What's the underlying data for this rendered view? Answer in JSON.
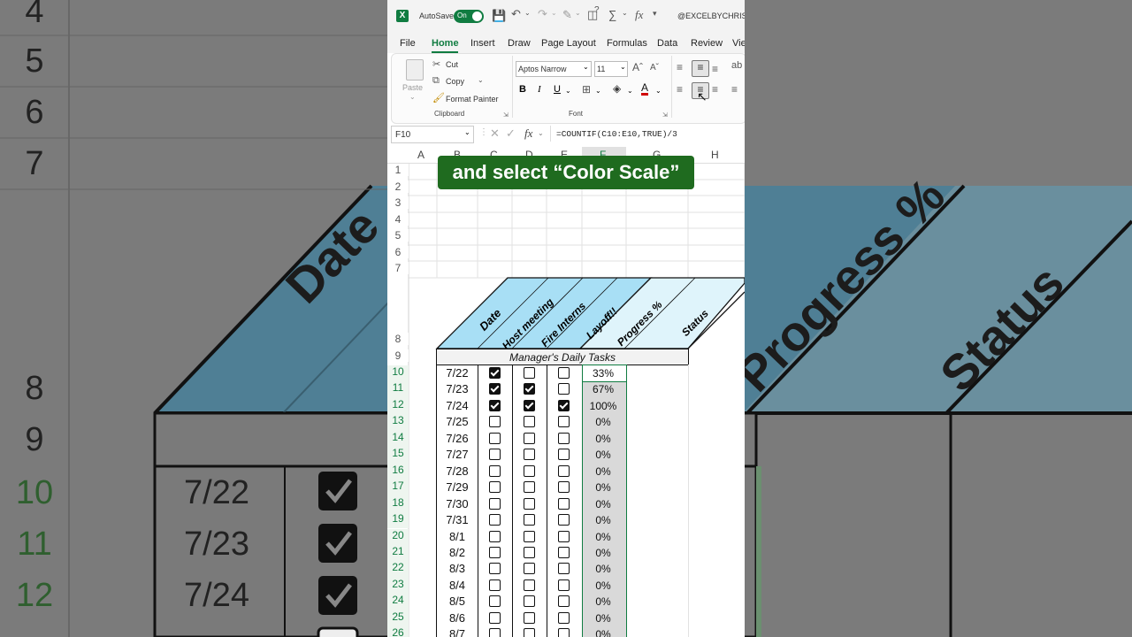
{
  "background": {
    "row_numbers": [
      "4",
      "5",
      "6",
      "7",
      "8",
      "9",
      "10",
      "11",
      "12"
    ],
    "dates": [
      "7/22",
      "7/23",
      "7/24"
    ],
    "headers": [
      "Date",
      "Progress %",
      "Status"
    ]
  },
  "titlebar": {
    "autosave_label": "AutoSave",
    "autosave_state": "On",
    "account": "@EXCELBYCHRIS T"
  },
  "tabs": [
    "File",
    "Home",
    "Insert",
    "Draw",
    "Page Layout",
    "Formulas",
    "Data",
    "Review",
    "Vie"
  ],
  "ribbon": {
    "paste": "Paste",
    "cut": "Cut",
    "copy": "Copy",
    "format_painter": "Format Painter",
    "clipboard_group": "Clipboard",
    "font_name": "Aptos Narrow",
    "font_size": "11",
    "font_group": "Font",
    "bold": "B",
    "italic": "I",
    "underline": "U"
  },
  "formula_bar": {
    "name_box": "F10",
    "formula": "=COUNTIF(C10:E10,TRUE)/3"
  },
  "columns": [
    "A",
    "B",
    "C",
    "D",
    "E",
    "F",
    "G",
    "H"
  ],
  "rows_top": [
    "1",
    "2",
    "3",
    "4",
    "5",
    "6",
    "7",
    "8",
    "9"
  ],
  "table": {
    "headers": [
      "Date",
      "Host meeting",
      "Fire Interns",
      "Layoff!!",
      "Progress %",
      "Status"
    ],
    "title": "Manager's Daily Tasks",
    "rows": [
      {
        "row": "10",
        "date": "7/22",
        "c": true,
        "d": false,
        "e": false,
        "pct": "33%"
      },
      {
        "row": "11",
        "date": "7/23",
        "c": true,
        "d": true,
        "e": false,
        "pct": "67%"
      },
      {
        "row": "12",
        "date": "7/24",
        "c": true,
        "d": true,
        "e": true,
        "pct": "100%"
      },
      {
        "row": "13",
        "date": "7/25",
        "c": false,
        "d": false,
        "e": false,
        "pct": "0%"
      },
      {
        "row": "14",
        "date": "7/26",
        "c": false,
        "d": false,
        "e": false,
        "pct": "0%"
      },
      {
        "row": "15",
        "date": "7/27",
        "c": false,
        "d": false,
        "e": false,
        "pct": "0%"
      },
      {
        "row": "16",
        "date": "7/28",
        "c": false,
        "d": false,
        "e": false,
        "pct": "0%"
      },
      {
        "row": "17",
        "date": "7/29",
        "c": false,
        "d": false,
        "e": false,
        "pct": "0%"
      },
      {
        "row": "18",
        "date": "7/30",
        "c": false,
        "d": false,
        "e": false,
        "pct": "0%"
      },
      {
        "row": "19",
        "date": "7/31",
        "c": false,
        "d": false,
        "e": false,
        "pct": "0%"
      },
      {
        "row": "20",
        "date": "8/1",
        "c": false,
        "d": false,
        "e": false,
        "pct": "0%"
      },
      {
        "row": "21",
        "date": "8/2",
        "c": false,
        "d": false,
        "e": false,
        "pct": "0%"
      },
      {
        "row": "22",
        "date": "8/3",
        "c": false,
        "d": false,
        "e": false,
        "pct": "0%"
      },
      {
        "row": "23",
        "date": "8/4",
        "c": false,
        "d": false,
        "e": false,
        "pct": "0%"
      },
      {
        "row": "24",
        "date": "8/5",
        "c": false,
        "d": false,
        "e": false,
        "pct": "0%"
      },
      {
        "row": "25",
        "date": "8/6",
        "c": false,
        "d": false,
        "e": false,
        "pct": "0%"
      },
      {
        "row": "26",
        "date": "8/7",
        "c": false,
        "d": false,
        "e": false,
        "pct": "0%"
      }
    ]
  },
  "caption": "and select “Color Scale”",
  "colors": {
    "excel_green": "#107c41",
    "header_blue": "#a8dff5",
    "header_light": "#dff4fb",
    "caption_bg": "#1f6b1f",
    "selected_fill": "#d9d9d9"
  }
}
